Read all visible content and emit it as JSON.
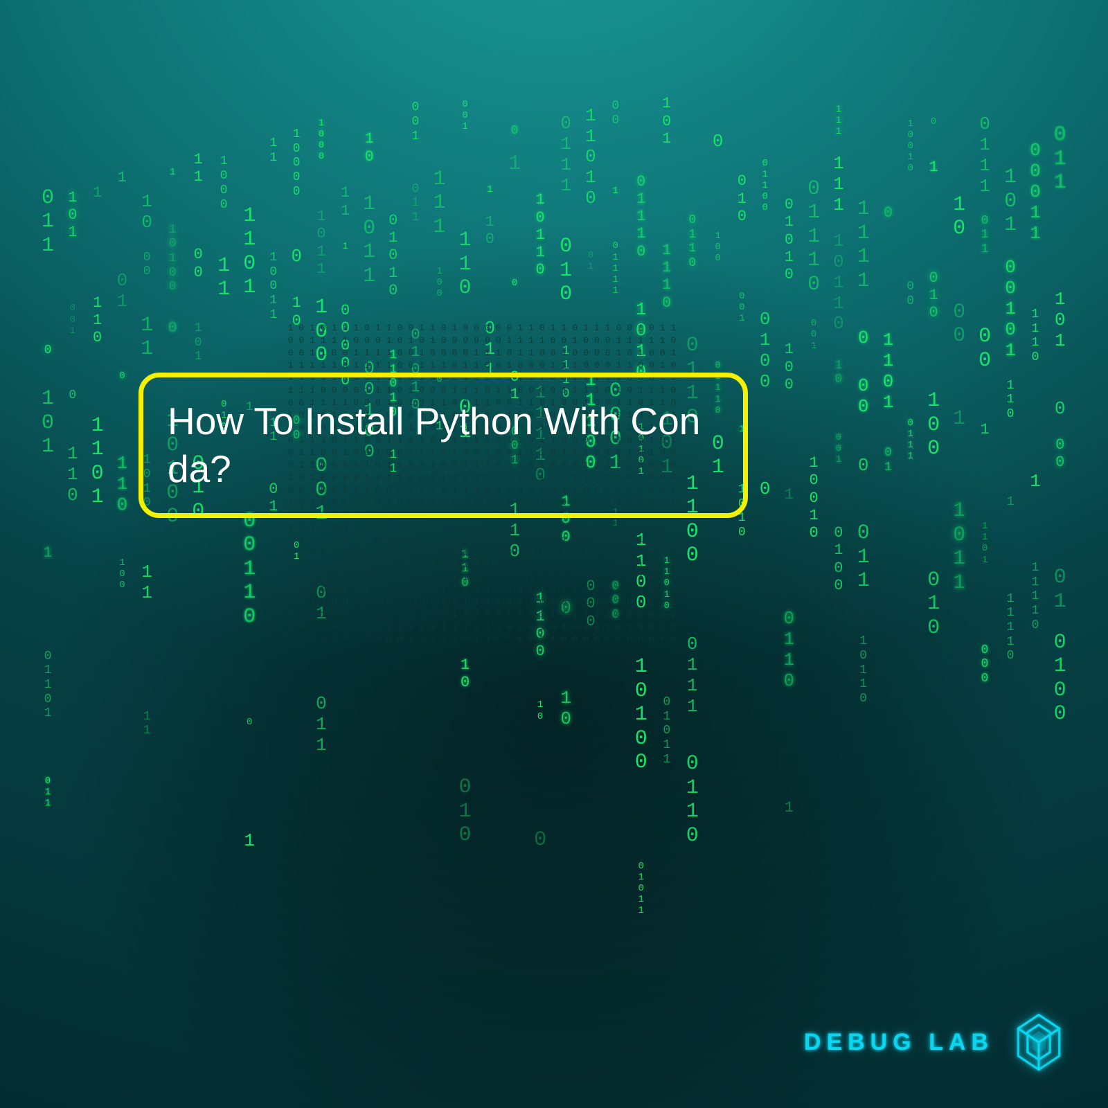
{
  "title": "How To Install Python With Conda?",
  "brand": "DEBUG LAB",
  "colors": {
    "accent_yellow": "#f3f000",
    "matrix_green": "#17e36a",
    "logo_cyan": "#0bd6f0"
  },
  "matrix_config": {
    "columns": 42,
    "font_sizes_px": [
      14,
      18,
      22,
      26,
      30
    ],
    "chars": [
      "0",
      "1"
    ]
  }
}
